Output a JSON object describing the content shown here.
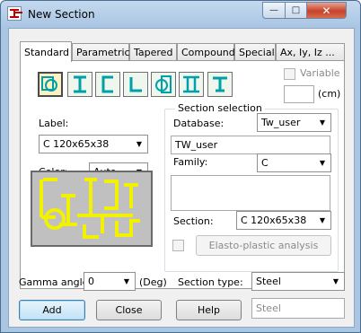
{
  "window": {
    "title": "New Section"
  },
  "tabs": [
    {
      "label": "Standard"
    },
    {
      "label": "Parametric"
    },
    {
      "label": "Tapered"
    },
    {
      "label": "Compound"
    },
    {
      "label": "Special"
    },
    {
      "label": "Ax, Iy, Iz ..."
    }
  ],
  "shapes": [
    "double-section-icon",
    "i-section-icon",
    "channel-section-icon",
    "angle-section-icon",
    "pipe-section-icon",
    "double-i-section-icon",
    "tee-section-icon"
  ],
  "variable": {
    "label": "Variable",
    "checked": false,
    "value": "",
    "unit": "(cm)"
  },
  "label_field": {
    "label": "Label:",
    "value": "C 120x65x38"
  },
  "color_field": {
    "label": "Color:",
    "value": "Auto"
  },
  "section_selection": {
    "title": "Section selection",
    "database_label": "Database:",
    "database_value": "Tw_user",
    "database_text": "TW_user",
    "family_label": "Family:",
    "family_value": "C",
    "section_label": "Section:",
    "section_value": "C 120x65x38"
  },
  "elasto_plastic": {
    "label": "Elasto-plastic analysis",
    "checked": false
  },
  "bottom": {
    "gamma_label": "Gamma angle:",
    "gamma_value": "0",
    "gamma_unit": "(Deg)",
    "section_type_label": "Section type:",
    "section_type_value": "Steel",
    "material_value": "Steel"
  },
  "buttons": {
    "add": "Add",
    "close": "Close",
    "help": "Help"
  },
  "colors": {
    "selected_shape_bg": "#fbf1c5",
    "shape_icon": "#00a0a8",
    "preview_yellow": "#f2f200",
    "preview_bg": "#c0c0c0"
  }
}
